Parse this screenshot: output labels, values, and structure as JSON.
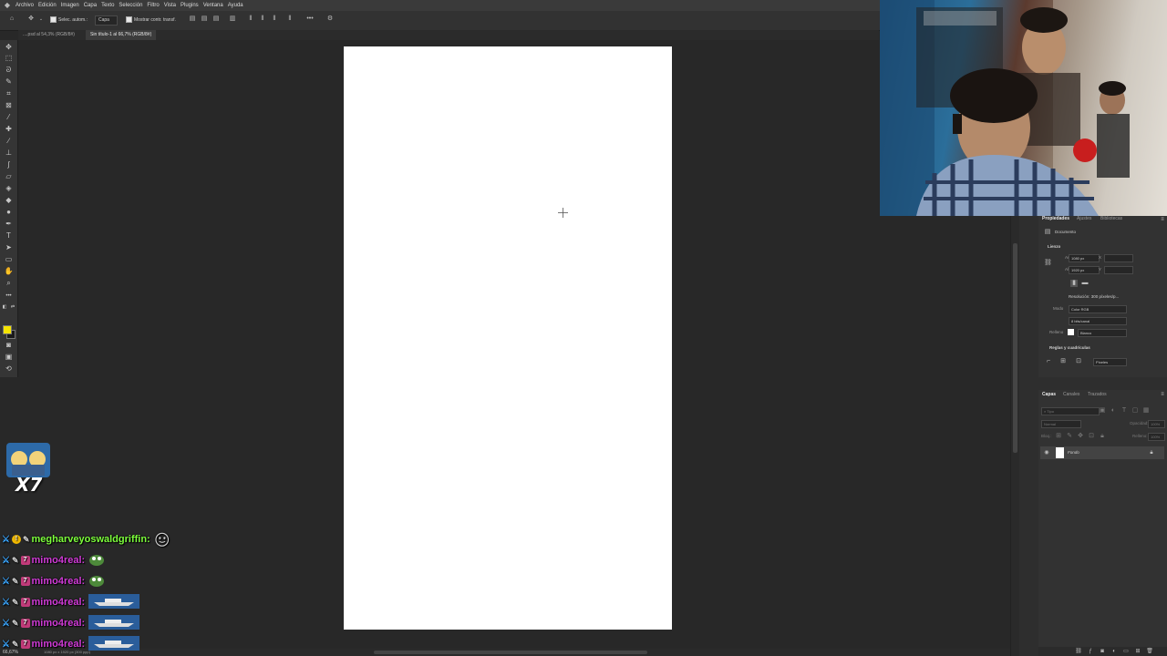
{
  "app": {
    "menu": [
      "Archivo",
      "Edición",
      "Imagen",
      "Capa",
      "Texto",
      "Selección",
      "Filtro",
      "Vista",
      "Plugins",
      "Ventana",
      "Ayuda"
    ]
  },
  "options_bar": {
    "auto_select_label": "Selec. autom.:",
    "auto_select_value": "Capa",
    "transform_label": "Mostrar contr. transf."
  },
  "tabs": [
    {
      "label": "....psd al 54,3% (RGB/8#)",
      "active": false
    },
    {
      "label": "Sin título-1 al 66,7% (RGB/8#)",
      "active": true
    }
  ],
  "properties": {
    "tabs": [
      "Propiedades",
      "Ajustes",
      "Bibliotecas"
    ],
    "section": "Documento",
    "lienzo_title": "Lienzo",
    "width_label": "An",
    "width_value": "1080 px",
    "height_label": "Al",
    "height_value": "1920 px",
    "x_label": "X",
    "y_label": "Y",
    "resolution": "Resolución: 300 píxeles/p...",
    "mode_label": "Modo",
    "mode_value": "Color RGB",
    "bits_value": "8 bits/canal",
    "fill_label": "Relleno",
    "fill_value": "Blanco",
    "rulers_title": "Reglas y cuadrículas",
    "units_value": "Píxeles"
  },
  "layers": {
    "tabs": [
      "Capas",
      "Canales",
      "Trazados"
    ],
    "search_placeholder": "Tipo",
    "blend_mode": "Normal",
    "opacity_label": "Opacidad:",
    "opacity_value": "100%",
    "lock_label": "Bloq.:",
    "fill_label": "Relleno:",
    "fill_value": "100%",
    "layer_name": "Fondo"
  },
  "status": {
    "zoom": "66,67%",
    "doc_info": "1080 px x 1920 px (300 ppp)"
  },
  "chat": {
    "badge_count": "X7",
    "messages": [
      {
        "user": "megharveyoswaldgriffin:",
        "color": "#7dff3c",
        "emote": "emoji-face"
      },
      {
        "user": "mimo4real:",
        "color": "#d13bd8",
        "emote": "pepe"
      },
      {
        "user": "mimo4real:",
        "color": "#d13bd8",
        "emote": "pepe"
      },
      {
        "user": "mimo4real:",
        "color": "#d13bd8",
        "emote": "boat"
      },
      {
        "user": "mimo4real:",
        "color": "#d13bd8",
        "emote": "boat"
      },
      {
        "user": "mimo4real:",
        "color": "#d13bd8",
        "emote": "boat"
      }
    ]
  },
  "colors": {
    "canvas": "#ffffff",
    "workspace": "#282828",
    "foreground_swatch": "#f5e400",
    "background_swatch": "#1a1a1a",
    "sword_badge": "#3ba6ff"
  }
}
